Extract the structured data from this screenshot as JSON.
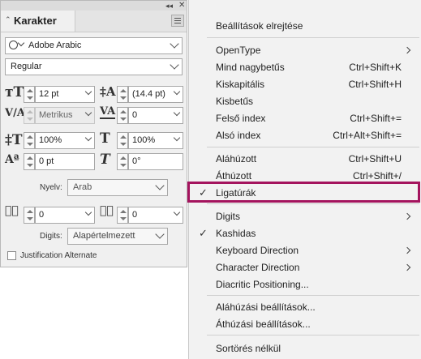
{
  "panel": {
    "tab_label": "Karakter",
    "font_family": "Adobe Arabic",
    "font_style": "Regular",
    "font_size": "12 pt",
    "leading": "(14.4 pt)",
    "kerning": "Metrikus",
    "tracking": "0",
    "vertical_scale": "100%",
    "horizontal_scale": "100%",
    "baseline_shift": "0 pt",
    "skew": "0°",
    "language_label": "Nyelv:",
    "language_value": "Arab",
    "diacritic_x": "0",
    "diacritic_y": "0",
    "digits_label": "Digits:",
    "digits_value": "Alapértelmezett",
    "justification_label": "Justification Alternate"
  },
  "menu": {
    "items": [
      {
        "label": "Beállítások elrejtése",
        "shortcut": ""
      },
      {
        "label": "OpenType",
        "shortcut": ""
      },
      {
        "label": "Mind nagybetűs",
        "shortcut": "Ctrl+Shift+K"
      },
      {
        "label": "Kiskapitális",
        "shortcut": "Ctrl+Shift+H"
      },
      {
        "label": "Kisbetűs",
        "shortcut": ""
      },
      {
        "label": "Felső index",
        "shortcut": "Ctrl+Shift+="
      },
      {
        "label": "Alsó index",
        "shortcut": "Ctrl+Alt+Shift+="
      },
      {
        "label": "Aláhúzott",
        "shortcut": "Ctrl+Shift+U"
      },
      {
        "label": "Áthúzott",
        "shortcut": "Ctrl+Shift+/"
      },
      {
        "label": "Ligatúrák",
        "shortcut": "",
        "checked": true
      },
      {
        "label": "Digits",
        "shortcut": ""
      },
      {
        "label": "Kashidas",
        "shortcut": "",
        "checked": true
      },
      {
        "label": "Keyboard Direction",
        "shortcut": ""
      },
      {
        "label": "Character Direction",
        "shortcut": ""
      },
      {
        "label": "Diacritic Positioning...",
        "shortcut": ""
      },
      {
        "label": "Aláhúzási beállítások...",
        "shortcut": ""
      },
      {
        "label": "Áthúzási beállítások...",
        "shortcut": ""
      },
      {
        "label": "Sortörés nélkül",
        "shortcut": ""
      }
    ],
    "check_glyph": "✓"
  },
  "colors": {
    "highlight_border": "#a4145e",
    "panel_bg": "#f0f0f0",
    "menu_bg": "#f2f2f2"
  },
  "icons": [
    "collapse-arrows-icon",
    "close-icon",
    "panel-menu-icon",
    "search-icon",
    "font-size-icon",
    "leading-icon",
    "kerning-icon",
    "tracking-icon",
    "vertical-scale-icon",
    "horizontal-scale-icon",
    "baseline-shift-icon",
    "skew-icon",
    "diacritic-x-icon",
    "diacritic-y-icon",
    "submenu-arrow-icon",
    "check-icon"
  ]
}
